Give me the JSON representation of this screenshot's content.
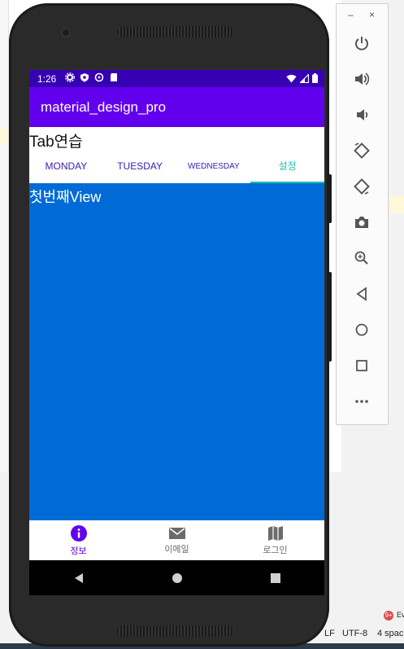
{
  "background_ide": {
    "status_line_ending": "LF",
    "status_encoding": "UTF-8",
    "status_indent": "4 spac",
    "event_badge": "9+",
    "event_label": "Ev"
  },
  "phone": {
    "status_bar": {
      "time": "1:26"
    },
    "app_bar": {
      "title": "material_design_pro"
    },
    "section_title": "Tab연습",
    "tabs": [
      {
        "label": "MONDAY"
      },
      {
        "label": "TUESDAY"
      },
      {
        "label": "WEDNESDAY"
      },
      {
        "label": "설정"
      }
    ],
    "active_tab": 3,
    "content": {
      "text": "첫번째View",
      "background": "#006bd6"
    },
    "bottom_nav": [
      {
        "label": "정보",
        "icon": "info-icon",
        "active": true
      },
      {
        "label": "이메일",
        "icon": "email-icon",
        "active": false
      },
      {
        "label": "로그인",
        "icon": "map-icon",
        "active": false
      }
    ],
    "colors": {
      "primary": "#6200ee",
      "primary_dark": "#3700b3",
      "accent": "#1fbfae"
    }
  },
  "emulator_toolbar": {
    "minimize_label": "–",
    "close_label": "×",
    "buttons": [
      "power-icon",
      "volume-up-icon",
      "volume-down-icon",
      "rotate-left-icon",
      "rotate-right-icon",
      "camera-icon",
      "zoom-icon",
      "back-icon",
      "home-icon",
      "overview-icon",
      "more-icon"
    ]
  }
}
